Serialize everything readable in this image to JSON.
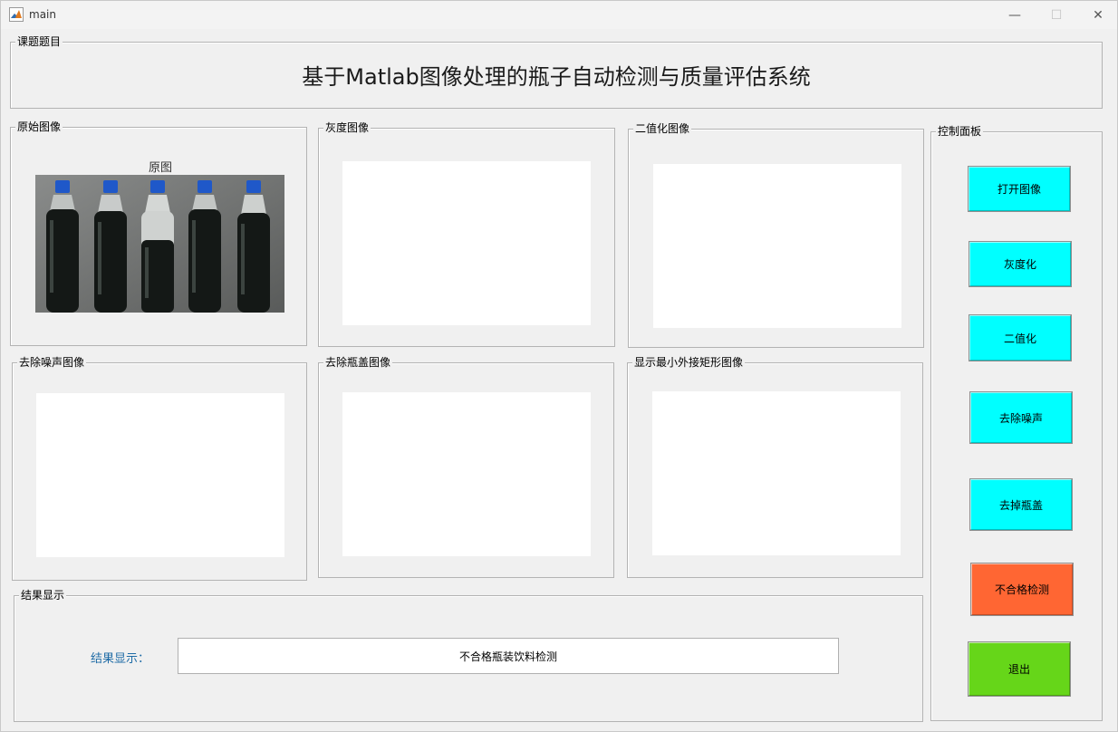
{
  "window": {
    "title": "main",
    "minimize_glyph": "—",
    "maximize_glyph": "☐",
    "close_glyph": "✕"
  },
  "title_panel": {
    "legend": "课题题目",
    "course_title": "基于Matlab图像处理的瓶子自动检测与质量评估系统"
  },
  "image_panels": {
    "original": {
      "legend": "原始图像",
      "caption": "原图"
    },
    "gray": {
      "legend": "灰度图像"
    },
    "binary": {
      "legend": "二值化图像"
    },
    "denoise": {
      "legend": "去除噪声图像"
    },
    "remove_cap": {
      "legend": "去除瓶盖图像"
    },
    "min_rect": {
      "legend": "显示最小外接矩形图像"
    }
  },
  "result_panel": {
    "legend": "结果显示",
    "label": "结果显示：",
    "value": "不合格瓶装饮料检测"
  },
  "control_panel": {
    "legend": "控制面板",
    "buttons": [
      {
        "label": "打开图像",
        "color": "#00ffff"
      },
      {
        "label": "灰度化",
        "color": "#00ffff"
      },
      {
        "label": "二值化",
        "color": "#00ffff"
      },
      {
        "label": "去除噪声",
        "color": "#00ffff"
      },
      {
        "label": "去掉瓶盖",
        "color": "#00ffff"
      },
      {
        "label": "不合格检测",
        "color": "#ff6633"
      },
      {
        "label": "退出",
        "color": "#66d619"
      }
    ]
  }
}
